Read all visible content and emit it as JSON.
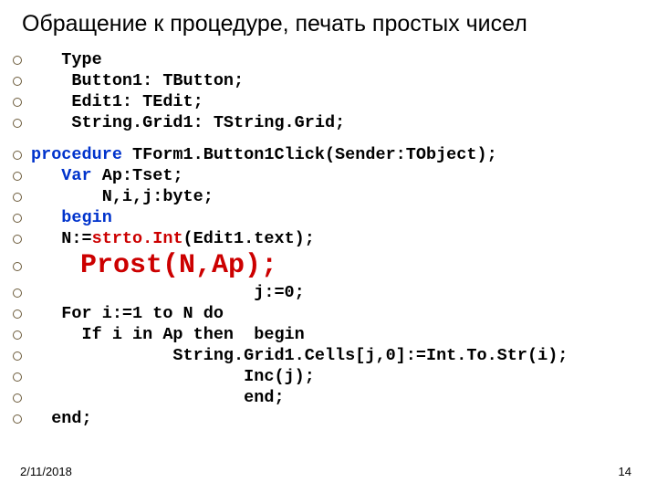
{
  "title": "Обращение к процедуре, печать простых чисел",
  "block1": {
    "l1": "   Type",
    "l2": "    Button1: TButton;",
    "l3": "    Edit1: TEdit;",
    "l4": "    String.Grid1: TString.Grid;"
  },
  "block2": {
    "l1_pre": "procedure",
    "l1_post": " TForm1.Button1Click(Sender:TObject);",
    "l2_pre": "   Var",
    "l2_post": " Ap:Tset;",
    "l3": "       N,i,j:byte;",
    "l4": "   begin",
    "l5_pre": "   N:=",
    "l5_fn": "strto.Int",
    "l5_post": "(Edit1.text);"
  },
  "call": "   Prost(N,Ap);",
  "block3": {
    "l1": "                      j:=0;",
    "l2": "   For i:=1 to N do",
    "l3": "     If i in Ap then  begin",
    "l4": "              String.Grid1.Cells[j,0]:=Int.To.Str(i);",
    "l5": "                     Inc(j);",
    "l6": "                     end;",
    "l7": "  end;"
  },
  "footer": {
    "date": "2/11/2018",
    "page": "14"
  }
}
